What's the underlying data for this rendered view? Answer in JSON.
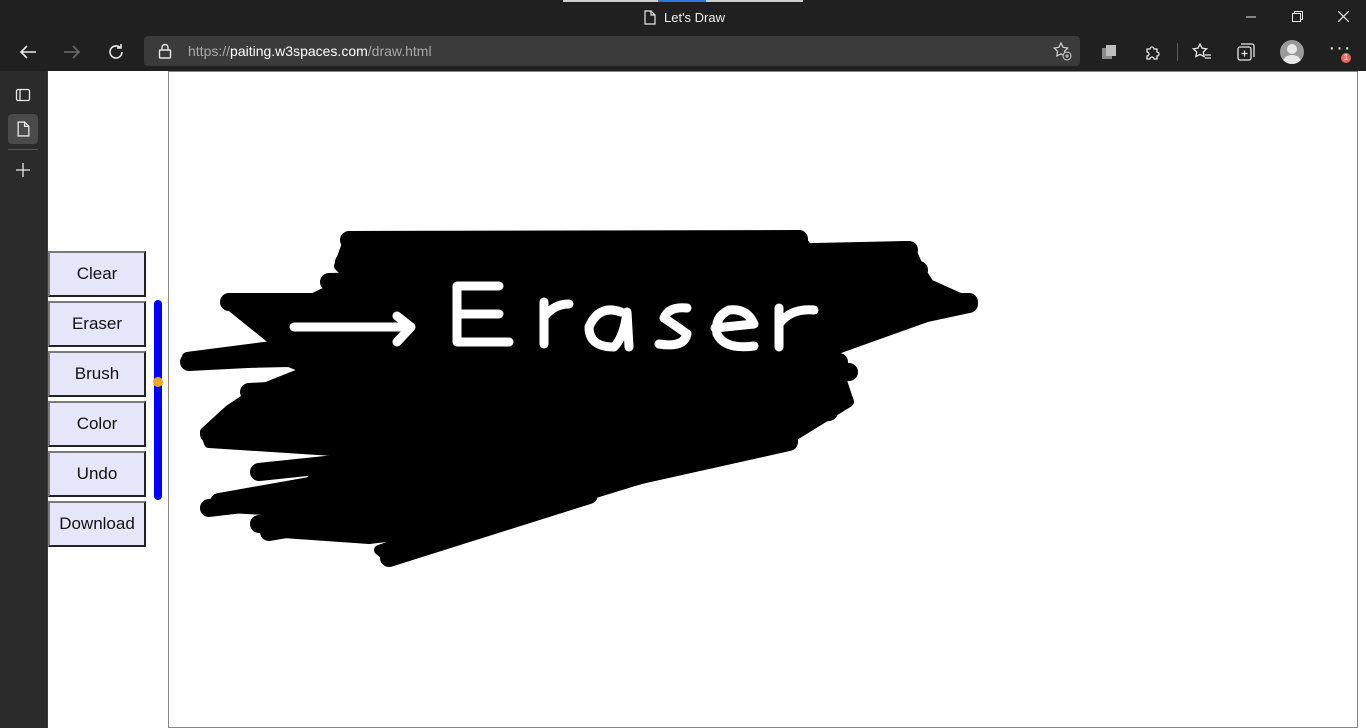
{
  "window": {
    "title": "Let's Draw",
    "controls": [
      "minimize",
      "restore",
      "close"
    ]
  },
  "toolbar": {
    "url_scheme": "https://",
    "url_host": "paiting.w3spaces.com",
    "url_path": "/draw.html",
    "notification_count": "1"
  },
  "page": {
    "buttons": {
      "clear": "Clear",
      "eraser": "Eraser",
      "brush": "Brush",
      "color": "Color",
      "undo": "Undo",
      "download": "Download"
    },
    "brush_size_slider": {
      "value_fraction": 0.41,
      "track_color": "#0000ff",
      "thumb_color": "#f5a623"
    },
    "canvas_drawing": {
      "stroke_color": "#000000",
      "written_text": "Eraser",
      "written_color": "#ffffff"
    }
  },
  "icons": [
    "back-icon",
    "forward-icon",
    "refresh-icon",
    "lock-icon",
    "add-favorite-icon",
    "collections-icon",
    "extensions-icon",
    "favorites-icon",
    "tab-actions-icon",
    "profile-icon",
    "more-icon",
    "page-icon"
  ]
}
